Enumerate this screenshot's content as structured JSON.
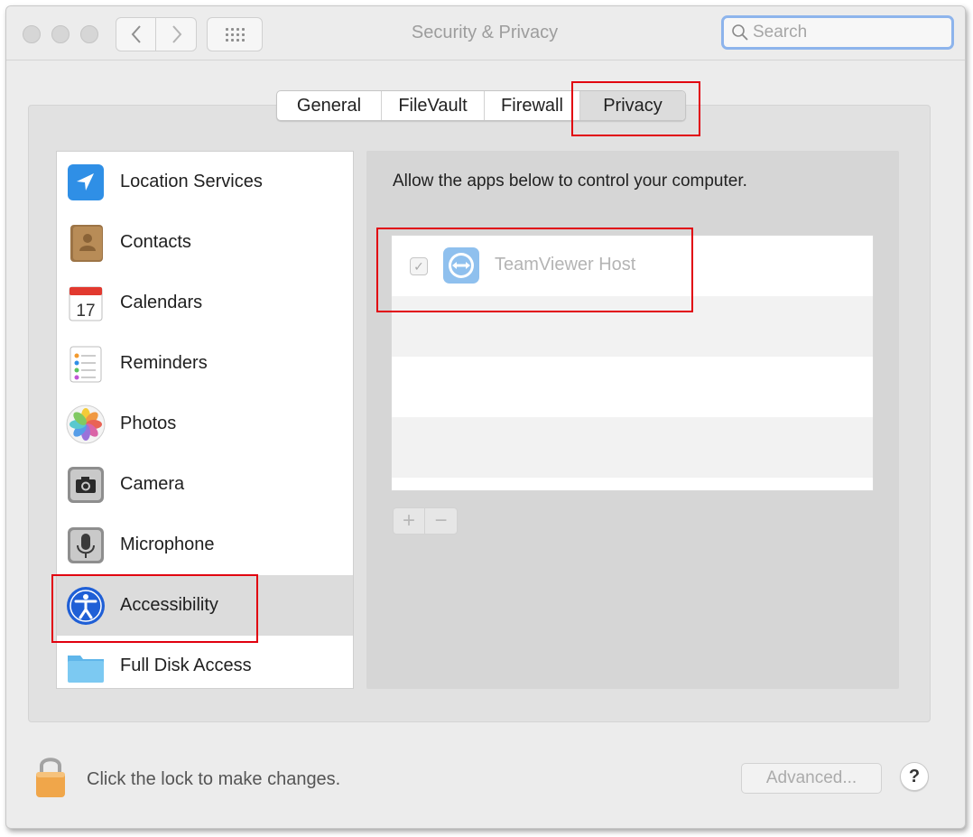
{
  "window": {
    "title": "Security & Privacy",
    "search_placeholder": "Search"
  },
  "tabs": [
    {
      "label": "General",
      "active": false
    },
    {
      "label": "FileVault",
      "active": false
    },
    {
      "label": "Firewall",
      "active": false
    },
    {
      "label": "Privacy",
      "active": true
    }
  ],
  "sidebar": {
    "items": [
      {
        "label": "Location Services",
        "icon": "location-arrow-icon"
      },
      {
        "label": "Contacts",
        "icon": "contacts-book-icon"
      },
      {
        "label": "Calendars",
        "icon": "calendar-icon",
        "icon_text": "17"
      },
      {
        "label": "Reminders",
        "icon": "reminders-icon"
      },
      {
        "label": "Photos",
        "icon": "photos-flower-icon"
      },
      {
        "label": "Camera",
        "icon": "camera-icon"
      },
      {
        "label": "Microphone",
        "icon": "microphone-icon"
      },
      {
        "label": "Accessibility",
        "icon": "accessibility-icon",
        "selected": true
      },
      {
        "label": "Full Disk Access",
        "icon": "folder-icon"
      }
    ]
  },
  "detail": {
    "description": "Allow the apps below to control your computer.",
    "apps": [
      {
        "name": "TeamViewer Host",
        "checked": true,
        "icon": "teamviewer-icon"
      }
    ],
    "add_label": "+",
    "remove_label": "−"
  },
  "footer": {
    "lock_text": "Click the lock to make changes.",
    "advanced_label": "Advanced...",
    "help_label": "?"
  },
  "colors": {
    "highlight": "#e1000f",
    "search_focus": "#8db4ec",
    "selected_row": "#dcdcdc"
  }
}
